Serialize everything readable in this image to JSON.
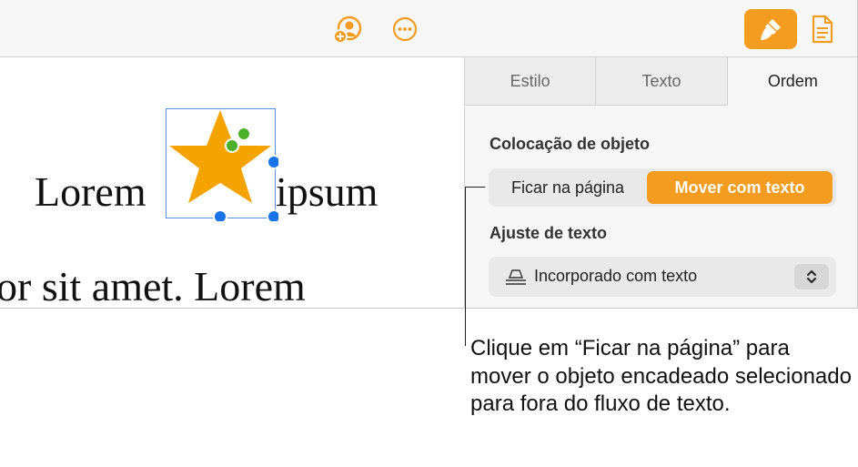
{
  "toolbar": {
    "icons": [
      "collaborate-icon",
      "more-icon",
      "format-paintbrush-icon",
      "document-icon"
    ],
    "accent": "#f39c1f"
  },
  "canvas": {
    "word_left": "Lorem",
    "word_right": "ipsum",
    "line2": "or sit amet. Lorem",
    "shape": "star",
    "shape_color": "#f5a300",
    "handle_color": "#1a73e8"
  },
  "sidebar": {
    "tabs": [
      {
        "label": "Estilo",
        "active": false
      },
      {
        "label": "Texto",
        "active": false
      },
      {
        "label": "Ordem",
        "active": true
      }
    ],
    "placement_title": "Colocação de objeto",
    "placement_options": {
      "stay_on_page": "Ficar na página",
      "move_with_text": "Mover com texto",
      "selected": "Mover com texto"
    },
    "wrap_title": "Ajuste de texto",
    "wrap_value": "Incorporado com texto"
  },
  "callout": {
    "text": "Clique em “Ficar na página” para mover o objeto encadeado selecionado para fora do fluxo de texto."
  }
}
